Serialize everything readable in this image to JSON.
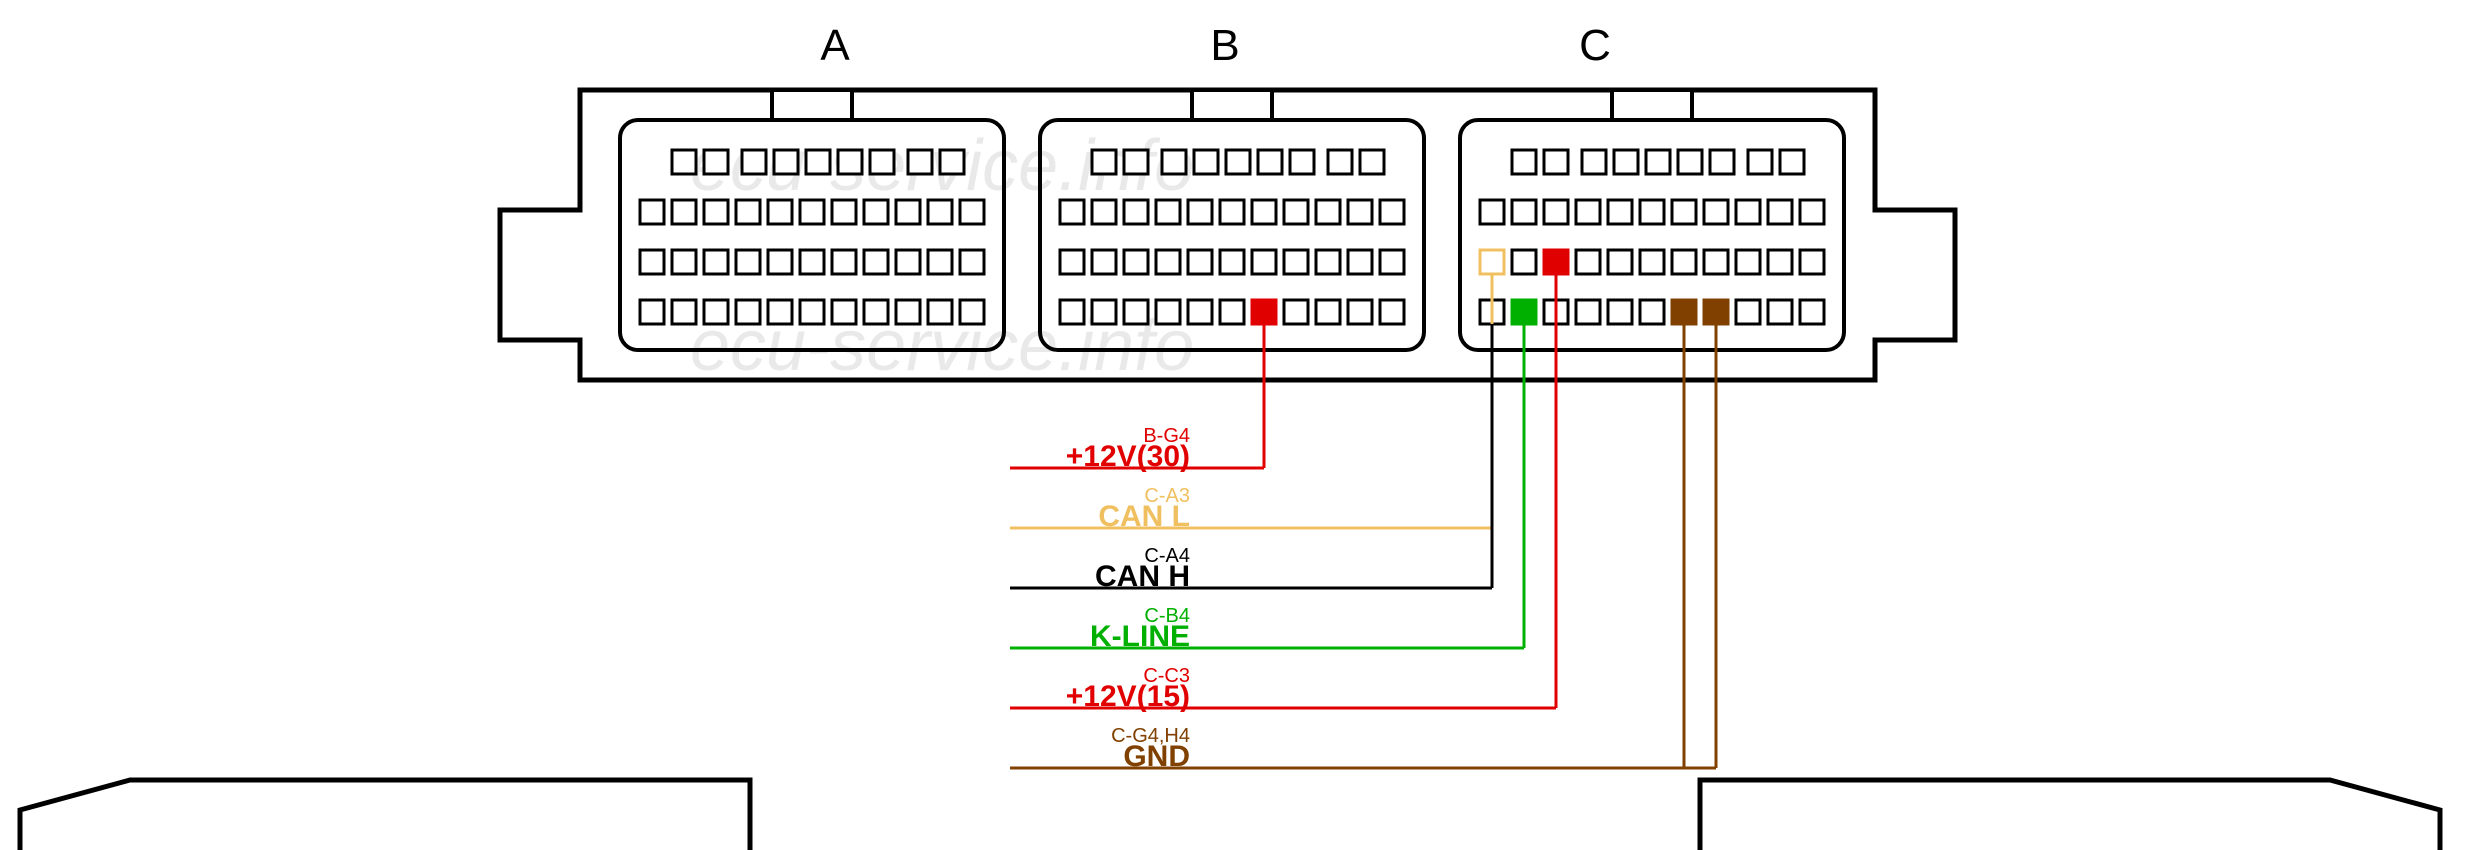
{
  "watermark_text": "ecu-service.info",
  "connectors": {
    "A": "A",
    "B": "B",
    "C": "C"
  },
  "signals": [
    {
      "pin": "B-G4",
      "name": "+12V(30)",
      "color": "#e10000"
    },
    {
      "pin": "C-A3",
      "name": "CAN L",
      "color": "#f0c060"
    },
    {
      "pin": "C-A4",
      "name": "CAN H",
      "color": "#000000"
    },
    {
      "pin": "C-B4",
      "name": "K-LINE",
      "color": "#00b000"
    },
    {
      "pin": "C-C3",
      "name": "+12V(15)",
      "color": "#e10000"
    },
    {
      "pin": "C-G4,H4",
      "name": "GND",
      "color": "#804000"
    }
  ],
  "colors": {
    "outline": "#000000",
    "pin_fill": "#ffffff"
  }
}
